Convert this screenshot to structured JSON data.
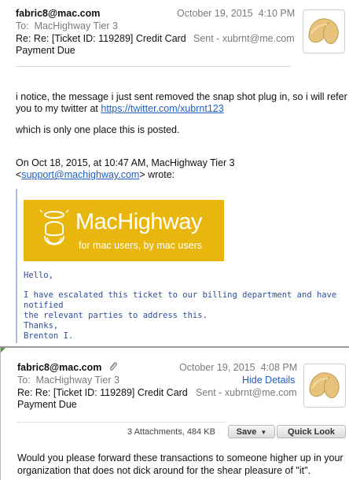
{
  "msg1": {
    "from": "fabric8@mac.com",
    "date": "October 19, 2015",
    "time": "4:10 PM",
    "to_label": "To:",
    "to": "MacHighway Tier 3",
    "subject_line1": "Re: Re: [Ticket ID: 119289] Credit Card",
    "subject_line2": "Payment Due",
    "sent": "Sent - xubrnt@me.com",
    "body_line1": "i notice, the message i just sent removed the snap shot plug in, so i will refer",
    "body_line2_prefix": "you to my twitter at ",
    "twitter_link": "https://twitter.com/xubrnt123",
    "body_line3": "which is only one place this is posted.",
    "quote_line1": "On Oct 18, 2015, at 10:47 AM, MacHighway Tier 3",
    "quote_lt": "<",
    "quote_email": "support@machighway.com",
    "quote_gt_wrote": "> wrote:",
    "banner": {
      "brand": "MacHighway",
      "tagline": "for mac users, by mac users",
      "bg_color": "#e8b60c"
    },
    "quoted_hello": "Hello,",
    "quoted_line1": "I have escalated this ticket to our billing department and have notified",
    "quoted_line2": "the relevant parties to address this.",
    "quoted_thanks": "Thanks,",
    "quoted_name": "Brenton I."
  },
  "msg2": {
    "from": "fabric8@mac.com",
    "date": "October 19, 2015",
    "time": "4:08 PM",
    "to_label": "To:",
    "to": "MacHighway Tier 3",
    "hide_details": "Hide Details",
    "subject_line1": "Re: Re: [Ticket ID: 119289] Credit Card",
    "subject_line2": "Payment Due",
    "sent": "Sent - xubrnt@me.com",
    "attachments": "3 Attachments, 484 KB",
    "save_label": "Save",
    "quicklook_label": "Quick Look",
    "body_line1": "Would you please forward these transactions to someone higher up in your",
    "body_line2": "organization that does not dick around for the shear pleasure of \"it\"."
  }
}
